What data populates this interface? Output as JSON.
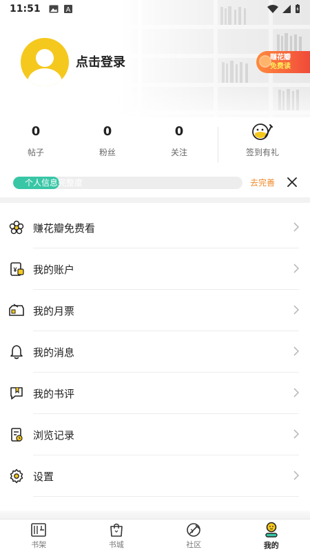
{
  "statusbar": {
    "time": "11:51"
  },
  "profile": {
    "login_text": "点击登录",
    "earn_badge": {
      "line1": "赚花瓣",
      "line2": "免费读"
    }
  },
  "stats": [
    {
      "value": "0",
      "label": "帖子"
    },
    {
      "value": "0",
      "label": "粉丝"
    },
    {
      "value": "0",
      "label": "关注"
    }
  ],
  "signin": {
    "label": "签到有礼",
    "icon": "smile-pen-icon"
  },
  "profile_progress": {
    "text": "个人信息完整度",
    "action": "去完善",
    "fraction": 0.2
  },
  "menu": [
    {
      "label": "赚花瓣免费看",
      "icon": "flower-icon"
    },
    {
      "label": "我的账户",
      "icon": "wallet-icon"
    },
    {
      "label": "我的月票",
      "icon": "ticket-icon"
    },
    {
      "label": "我的消息",
      "icon": "bell-icon"
    },
    {
      "label": "我的书评",
      "icon": "review-icon"
    },
    {
      "label": "浏览记录",
      "icon": "history-icon"
    },
    {
      "label": "设置",
      "icon": "gear-icon"
    }
  ],
  "tabs": [
    {
      "label": "书架",
      "icon": "bookshelf-icon",
      "active": false
    },
    {
      "label": "书城",
      "icon": "shopping-bag-icon",
      "active": false
    },
    {
      "label": "社区",
      "icon": "community-icon",
      "active": false
    },
    {
      "label": "我的",
      "icon": "profile-icon",
      "active": true
    }
  ],
  "colors": {
    "accent": "#38c6a6",
    "action_orange": "#f08a2a",
    "avatar_yellow": "#f5c81e",
    "badge_red": "#f04a3a"
  }
}
